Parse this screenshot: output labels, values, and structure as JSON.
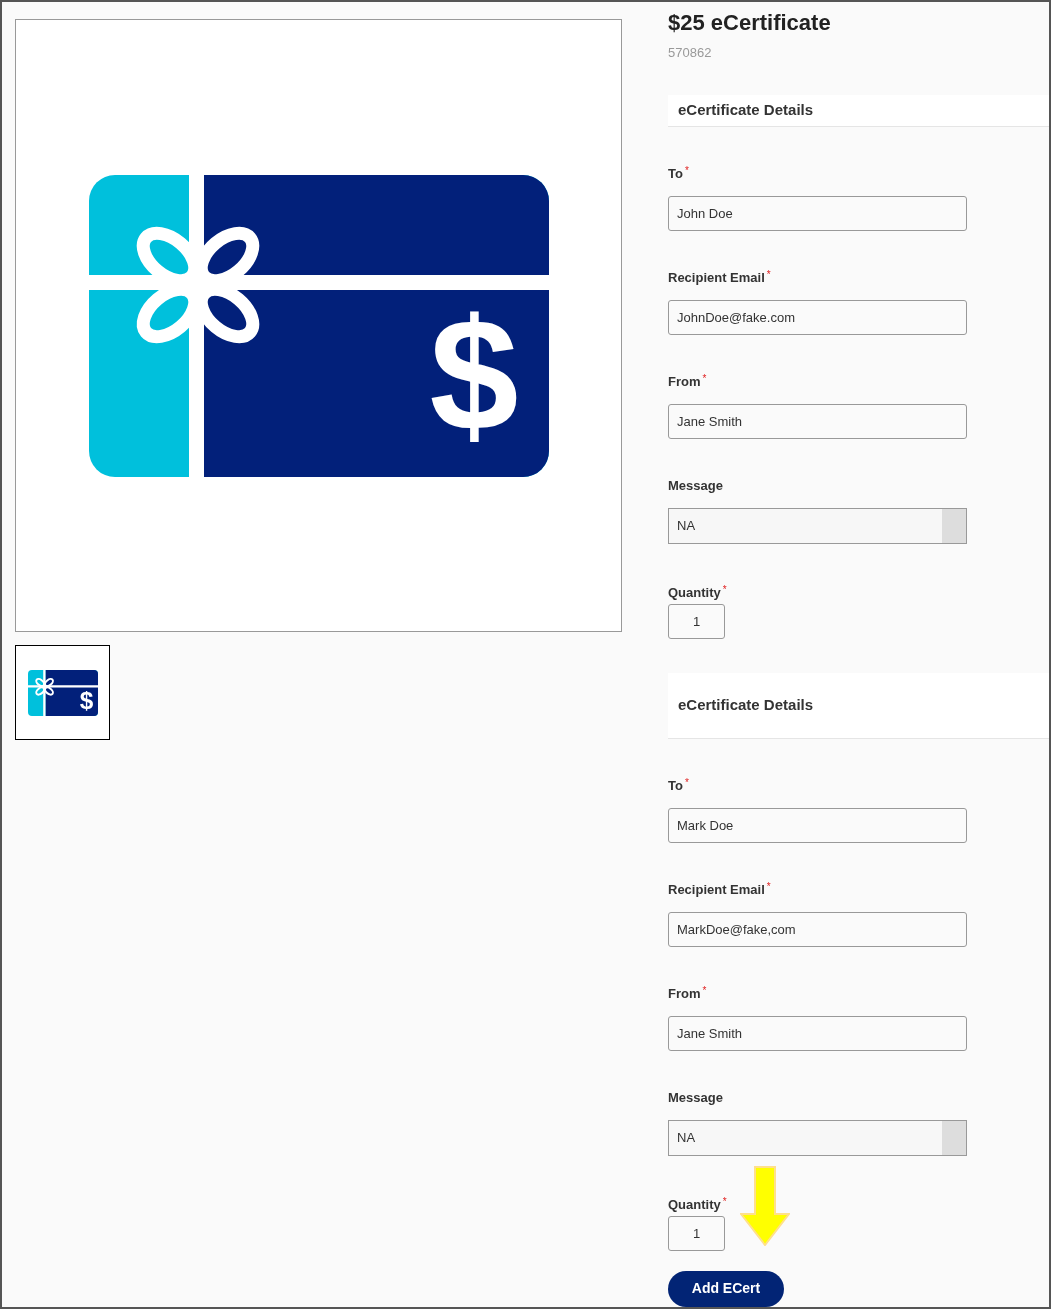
{
  "product": {
    "title": "$25 eCertificate",
    "sku": "570862",
    "image_glyph": "$",
    "thumbnail_glyph": "$"
  },
  "sections": [
    {
      "heading": "eCertificate Details",
      "fields": [
        {
          "kind": "text",
          "label": "To",
          "required_mark": "*",
          "value": "John Doe"
        },
        {
          "kind": "text",
          "label": "Recipient Email",
          "required_mark": "*",
          "value": "JohnDoe@fake.com"
        },
        {
          "kind": "text",
          "label": "From",
          "required_mark": "*",
          "value": "Jane Smith"
        },
        {
          "kind": "textarea",
          "label": "Message",
          "value": "NA"
        },
        {
          "kind": "quantity",
          "label": "Quantity",
          "required_mark": "*",
          "value": "1"
        }
      ]
    },
    {
      "heading": "eCertificate Details",
      "fields": [
        {
          "kind": "text",
          "label": "To",
          "required_mark": "*",
          "value": "Mark Doe"
        },
        {
          "kind": "text",
          "label": "Recipient Email",
          "required_mark": "*",
          "value": "MarkDoe@fake,com"
        },
        {
          "kind": "text",
          "label": "From",
          "required_mark": "*",
          "value": "Jane Smith"
        },
        {
          "kind": "textarea",
          "label": "Message",
          "value": "NA"
        },
        {
          "kind": "quantity",
          "label": "Quantity",
          "required_mark": "*",
          "value": "1"
        }
      ]
    }
  ],
  "button": "Add ECert"
}
